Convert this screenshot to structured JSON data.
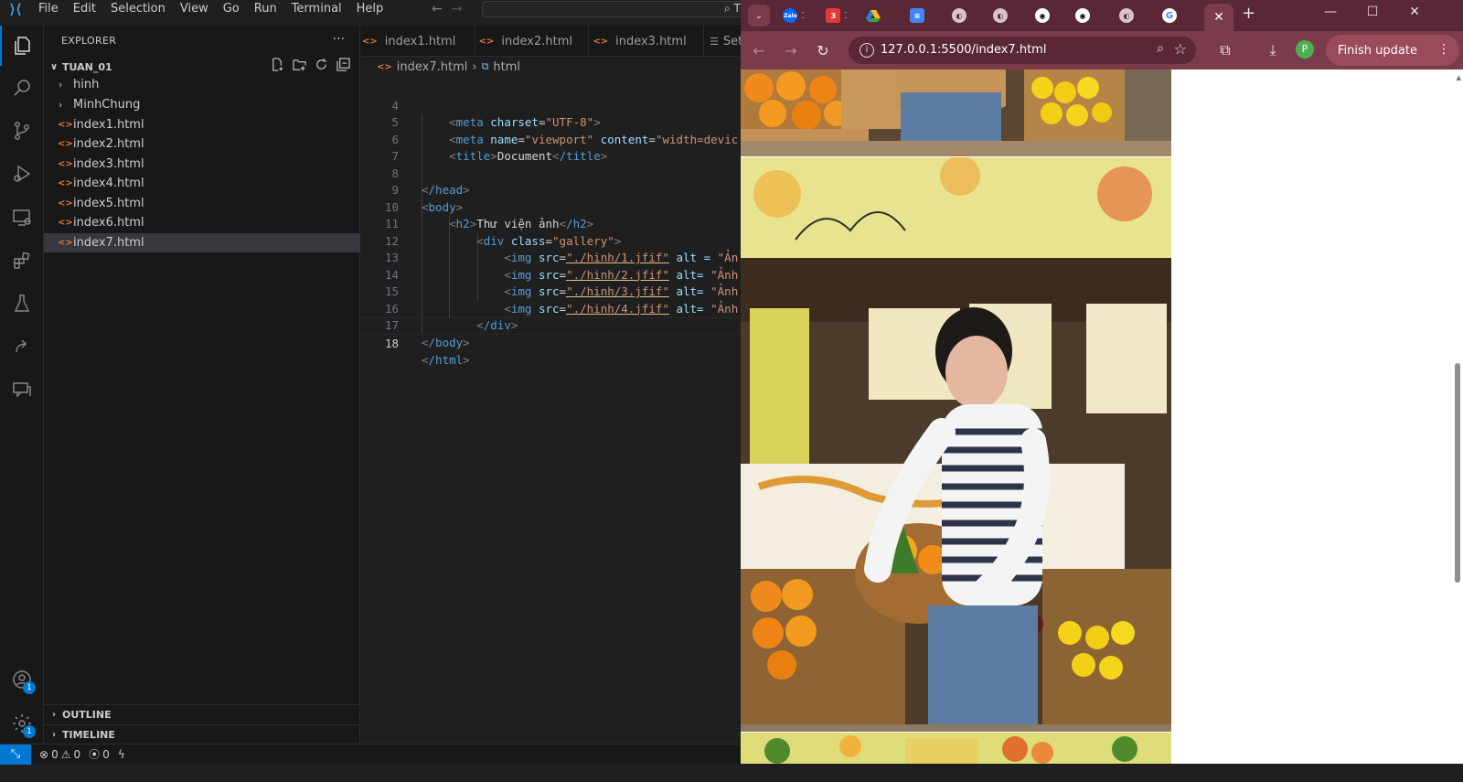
{
  "vscode": {
    "logo": "⟩⟨",
    "menu": [
      "File",
      "Edit",
      "Selection",
      "View",
      "Go",
      "Run",
      "Terminal",
      "Help"
    ],
    "command_center_text": "⌕ TU",
    "explorer": {
      "title": "EXPLORER",
      "more": "···",
      "folder": "TUAN_01",
      "items": [
        {
          "type": "folder",
          "name": "hinh"
        },
        {
          "type": "folder",
          "name": "MinhChung"
        },
        {
          "type": "file",
          "name": "index1.html"
        },
        {
          "type": "file",
          "name": "index2.html"
        },
        {
          "type": "file",
          "name": "index3.html"
        },
        {
          "type": "file",
          "name": "index4.html"
        },
        {
          "type": "file",
          "name": "index5.html"
        },
        {
          "type": "file",
          "name": "index6.html"
        },
        {
          "type": "file",
          "name": "index7.html",
          "selected": true
        }
      ],
      "outline": "OUTLINE",
      "timeline": "TIMELINE"
    },
    "tabs": [
      "index1.html",
      "index2.html",
      "index3.html",
      "Set"
    ],
    "breadcrumb": {
      "file": "index7.html",
      "sep": "›",
      "node": "html"
    },
    "code_lines": [
      4,
      5,
      6,
      7,
      8,
      9,
      10,
      11,
      12,
      13,
      14,
      15,
      16,
      17,
      18
    ],
    "current_line": 18,
    "code": {
      "l4": {
        "tag": "meta",
        "attr": "charset",
        "val": "\"UTF-8\""
      },
      "l5": {
        "tag": "meta",
        "attr1": "name",
        "val1": "\"viewport\"",
        "attr2": "content",
        "val2": "\"width=devic"
      },
      "l6": {
        "open": "title",
        "text": "Document",
        "close": "/title"
      },
      "l8": "/head",
      "l9": "body",
      "l10": {
        "open": "h2",
        "text": "Thư viện ảnh",
        "close": "/h2"
      },
      "l11": {
        "tag": "div",
        "attr": "class",
        "val": "\"gallery\""
      },
      "imgs": [
        {
          "src": "\"./hinh/1.jfif\"",
          "alt": "alt = ",
          "altval": "\"Ản"
        },
        {
          "src": "\"./hinh/2.jfif\"",
          "alt": "alt= ",
          "altval": "\"Ảnh"
        },
        {
          "src": "\"./hinh/3.jfif\"",
          "alt": "alt= ",
          "altval": "\"Ảnh"
        },
        {
          "src": "\"./hinh/4.jfif\"",
          "alt": "alt= ",
          "altval": "\"Ảnh"
        }
      ],
      "l16": "/div",
      "l17": "/body",
      "l18": "/html"
    },
    "status": {
      "errors": "0",
      "warnings": "0",
      "ports": "0"
    },
    "badges": {
      "accounts": "1",
      "settings": "1"
    }
  },
  "chrome": {
    "tab_favicons": [
      "zalo-icon",
      "calendar-icon",
      "drive-icon",
      "docs-icon",
      "globe-icon",
      "globe-icon",
      "github-icon",
      "github-icon",
      "globe-icon",
      "google-icon"
    ],
    "zalo_text": "Zalo",
    "calendar_badge": "3",
    "url": "127.0.0.1:5500/index7.html",
    "profile_initial": "P",
    "finish_update": "Finish update",
    "colors": {
      "frame": "#5a2737",
      "toolbar": "#7a3b4b",
      "accent": "#9b4a5c"
    }
  }
}
